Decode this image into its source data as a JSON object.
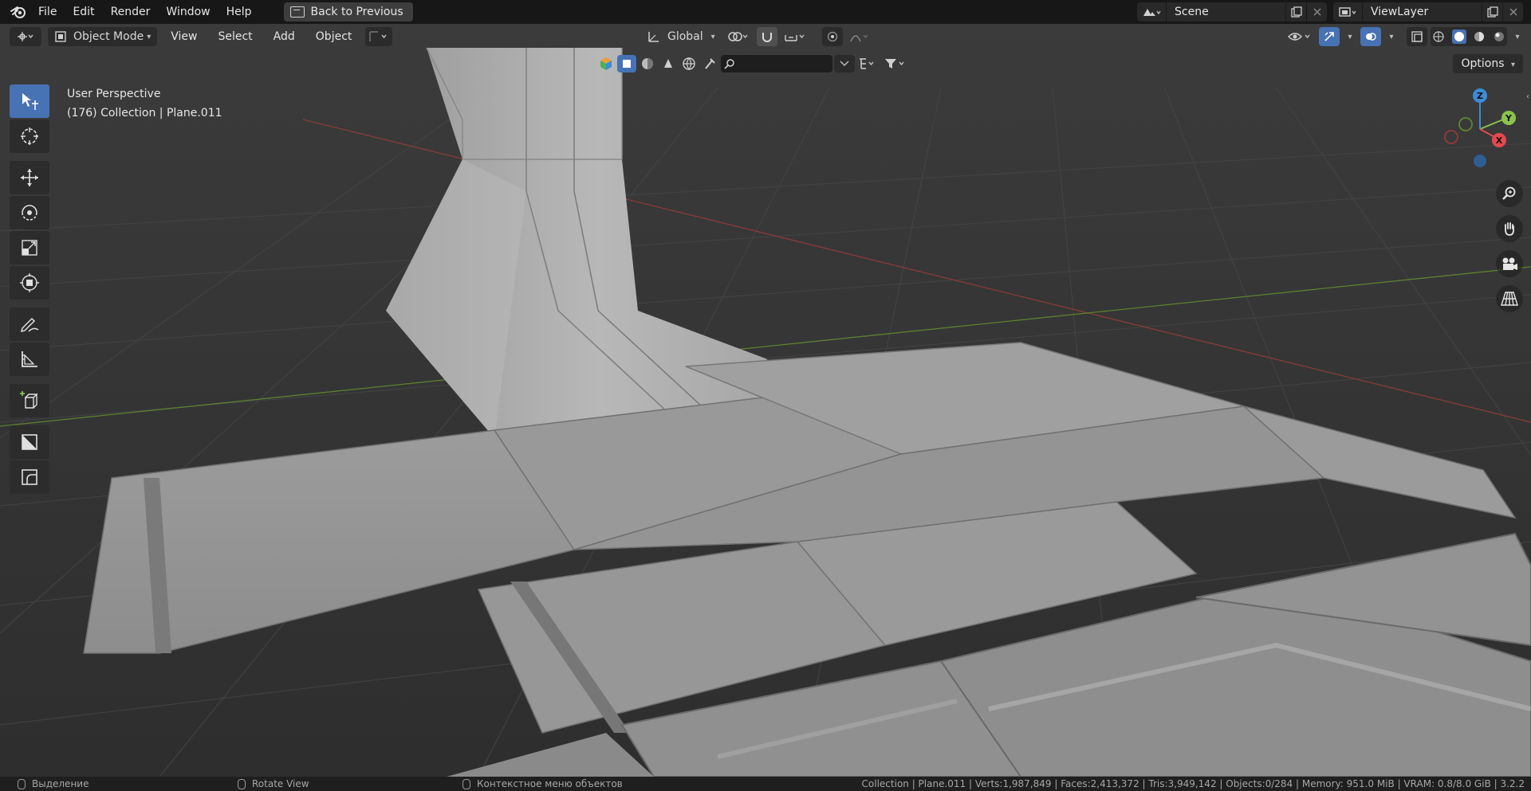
{
  "topbar": {
    "menus": [
      "File",
      "Edit",
      "Render",
      "Window",
      "Help"
    ],
    "back_button": "Back to Previous",
    "scene": "Scene",
    "view_layer": "ViewLayer"
  },
  "header": {
    "mode": "Object Mode",
    "menus": [
      "View",
      "Select",
      "Add",
      "Object"
    ],
    "transform_orientation": "Global",
    "options_label": "Options"
  },
  "viewport": {
    "perspective_label": "User Perspective",
    "collection_label": "(176) Collection | Plane.011",
    "gizmo": {
      "z": "Z",
      "y": "Y",
      "x": "X"
    }
  },
  "statusbar": {
    "left_action": "Выделение",
    "middle_action": "Rotate View",
    "right_action": "Контекстное меню объектов",
    "stats": "Collection | Plane.011 | Verts:1,987,849 | Faces:2,413,372 | Tris:3,949,142 | Objects:0/284 | Memory: 951.0 MiB | VRAM: 0.8/8.0 GiB | 3.2.2"
  },
  "colors": {
    "accent": "#4772b3",
    "axis_x": "#e5484d",
    "axis_y": "#8bc34a",
    "axis_z": "#3d8bd9"
  }
}
